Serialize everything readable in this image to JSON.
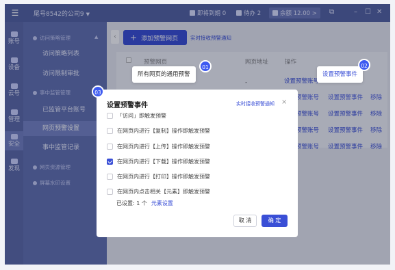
{
  "topbar": {
    "company": "尾号8542的公司9",
    "stats": [
      "即将到期 0",
      "待办 2",
      "余额 12.00 >"
    ]
  },
  "iconbar": [
    {
      "label": "账号",
      "icon": "account-icon"
    },
    {
      "label": "设备",
      "icon": "device-icon"
    },
    {
      "label": "云号",
      "icon": "cloud-icon"
    },
    {
      "label": "管理",
      "icon": "manage-icon"
    },
    {
      "label": "安全",
      "icon": "shield-icon"
    },
    {
      "label": "发现",
      "icon": "discover-icon"
    }
  ],
  "submenu": {
    "sections": [
      "访问策略管理",
      "事中监管管理",
      "网页资源管理",
      "屏幕水印设置"
    ],
    "items": [
      "访问策略列表",
      "访问限制审批",
      "已监管平台账号",
      "网页预警设置",
      "事中监管记录"
    ]
  },
  "content": {
    "add_button": "添加预警网页",
    "notify_link": "实时接收预警通知",
    "columns": [
      "预警网页",
      "网页地址",
      "操作"
    ],
    "dash": "-",
    "row_actions": [
      "设置预警账号",
      "设置预警事件",
      "移除"
    ]
  },
  "callouts": {
    "c1": {
      "text": "所有网页的通用预警",
      "badge": "01"
    },
    "c2": {
      "text": "设置预警事件",
      "badge": "02"
    },
    "c3": {
      "badge": "03"
    }
  },
  "modal": {
    "title": "设置预警事件",
    "link": "实时接收预警通知",
    "close": "×",
    "options": [
      {
        "text": "「访问」即触发预警",
        "checked": false
      },
      {
        "text": "在网页内进行【复制】操作即触发预警",
        "checked": false
      },
      {
        "text": "在网页内进行【上传】操作即触发预警",
        "checked": false
      },
      {
        "text": "在网页内进行【下载】操作即触发预警",
        "checked": true
      },
      {
        "text": "在网页内进行【打印】操作即触发预警",
        "checked": false
      },
      {
        "text": "在网页内点击相关【元素】即触发预警",
        "checked": false
      }
    ],
    "set_info": "已设置: 1 个",
    "element_link": "元素设置",
    "cancel": "取 消",
    "confirm": "确 定"
  }
}
